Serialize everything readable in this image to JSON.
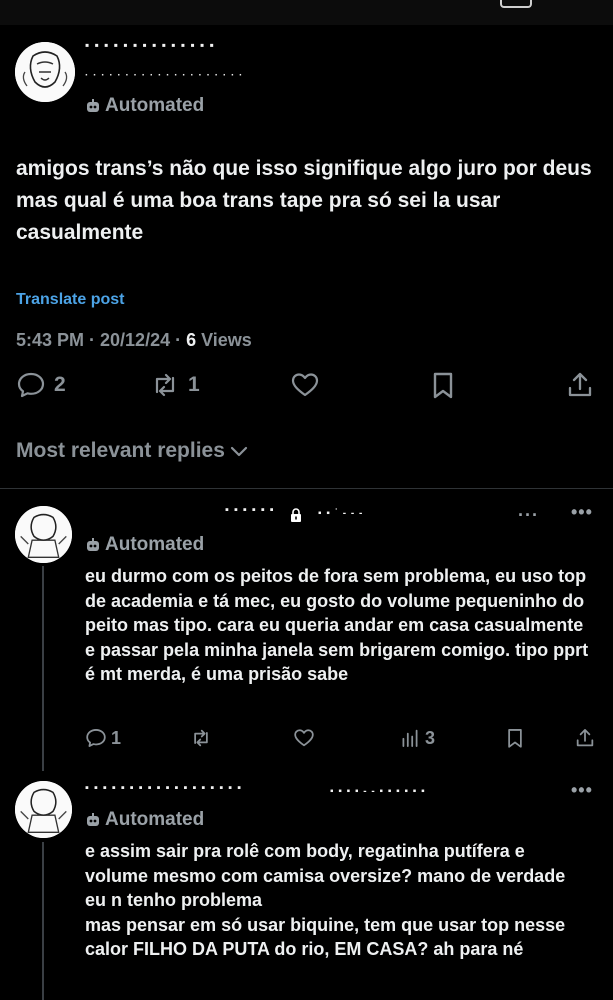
{
  "post": {
    "badge_label": "Automated",
    "text": "amigos trans’s não que isso signifique algo juro por deus mas qual é uma boa trans tape pra só sei la usar casualmente",
    "translate_label": "Translate post",
    "time_date": "5:43 PM · 20/12/24 · ",
    "views_count": "6",
    "views_label": " Views",
    "reply_count": "2",
    "repost_count": "1",
    "relevant_label": "Most relevant replies"
  },
  "replies": [
    {
      "badge_label": "Automated",
      "text": "eu durmo com os peitos de fora sem problema, eu uso top de academia e tá mec, eu gosto do volume pequeninho do peito mas tipo. cara eu queria andar em casa casualmente e passar pela minha janela sem brigarem comigo. tipo pprt é mt merda, é uma prisão sabe",
      "reply_count": "1",
      "views_count": "3"
    },
    {
      "badge_label": "Automated",
      "text": "e assim sair pra rolê com body, regatinha putífera e volume mesmo com camisa oversize? mano de verdade eu n tenho problema\nmas pensar em só usar biquine, tem que usar top nesse calor FILHO DA PUTA do rio, EM CASA? ah para né"
    }
  ],
  "icons": {
    "badge": "robot-icon",
    "reply": "speech-bubble-icon",
    "repost": "repost-arrows-icon",
    "like": "heart-icon",
    "bookmark": "bookmark-icon",
    "share": "share-upload-icon",
    "views": "bar-chart-icon",
    "more": "more-dots-icon",
    "lock": "lock-icon",
    "dropdown": "chevron-down-icon"
  },
  "colors": {
    "background": "#000000",
    "text": "#e7e9ea",
    "muted": "#8b9298",
    "link": "#4ca3e6"
  }
}
